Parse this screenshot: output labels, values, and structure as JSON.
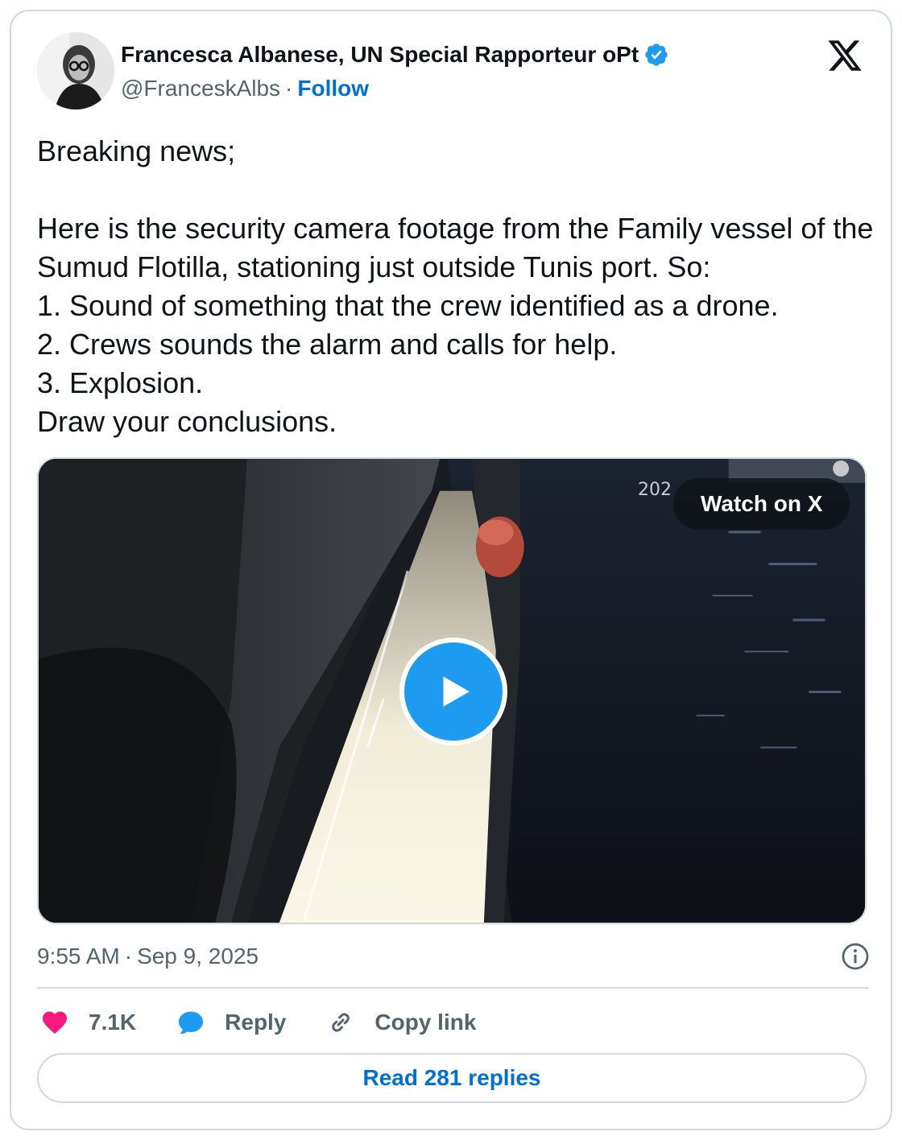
{
  "author": {
    "name": "Francesca Albanese, UN Special Rapporteur oPt",
    "handle": "@FranceskAlbs",
    "separator": "·",
    "follow_label": "Follow",
    "verified": true
  },
  "tweet": {
    "text": "Breaking news;\n\nHere is the security camera footage from the Family vessel of the Sumud Flotilla, stationing just outside Tunis port. So:\n1. Sound of something that the crew identified as a drone.\n2. Crews sounds the alarm and calls for help.\n3. Explosion.\nDraw your conclusions."
  },
  "media": {
    "overlay_timestamp": "202",
    "watch_label": "Watch on X",
    "play_icon": "play-icon"
  },
  "meta": {
    "time": "9:55 AM",
    "separator": "·",
    "date": "Sep 9, 2025"
  },
  "actions": {
    "like_count": "7.1K",
    "reply_label": "Reply",
    "copy_link_label": "Copy link"
  },
  "footer": {
    "read_replies_label": "Read 281 replies"
  },
  "colors": {
    "accent": "#1d9bf0",
    "link": "#006fd6",
    "like": "#f91880",
    "secondary_text": "#536471",
    "border": "#cfd9de"
  }
}
